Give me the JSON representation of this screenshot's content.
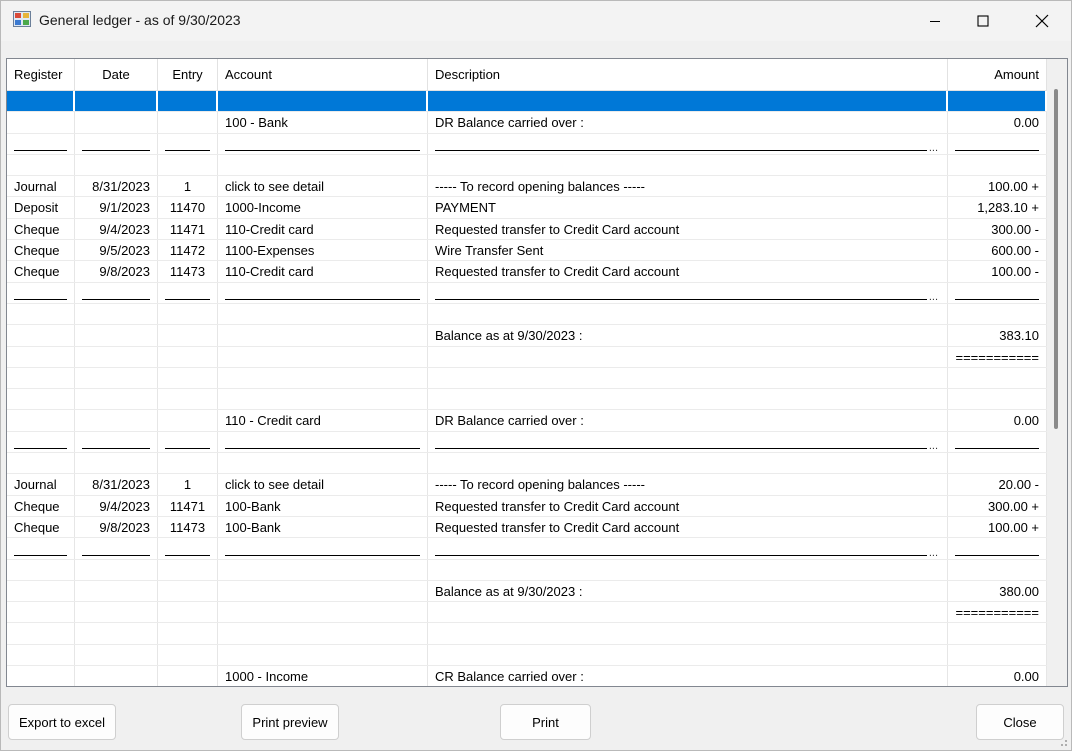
{
  "window": {
    "title": "General ledger - as of 9/30/2023",
    "icon": "ledger-app-icon",
    "controls": [
      "minimize-icon",
      "maximize-icon",
      "close-icon"
    ]
  },
  "grid": {
    "columns": [
      "Register",
      "Date",
      "Entry",
      "Account",
      "Description",
      "Amount"
    ],
    "rows": [
      {
        "type": "selected",
        "cells": [
          "",
          "",
          "",
          "",
          "",
          ""
        ]
      },
      {
        "type": "data",
        "cells": [
          "",
          "",
          "",
          "100 - Bank",
          "DR  Balance carried over  :",
          "0.00"
        ]
      },
      {
        "type": "underline"
      },
      {
        "type": "blank"
      },
      {
        "type": "data",
        "cells": [
          "Journal",
          "8/31/2023",
          "1",
          "click to see detail",
          "----- To record opening balances -----",
          "100.00 +"
        ]
      },
      {
        "type": "data",
        "cells": [
          "Deposit",
          "9/1/2023",
          "11470",
          "1000-Income",
          "PAYMENT",
          "1,283.10 +"
        ]
      },
      {
        "type": "data",
        "cells": [
          "Cheque",
          "9/4/2023",
          "11471",
          "110-Credit card",
          "Requested transfer to Credit Card account",
          "300.00 -"
        ]
      },
      {
        "type": "data",
        "cells": [
          "Cheque",
          "9/5/2023",
          "11472",
          "1100-Expenses",
          "Wire Transfer Sent",
          "600.00 -"
        ]
      },
      {
        "type": "data",
        "cells": [
          "Cheque",
          "9/8/2023",
          "11473",
          "110-Credit card",
          "Requested transfer to Credit Card account",
          "100.00 -"
        ]
      },
      {
        "type": "underline"
      },
      {
        "type": "blank"
      },
      {
        "type": "data",
        "cells": [
          "",
          "",
          "",
          "",
          "Balance as at 9/30/2023 :",
          "383.10"
        ]
      },
      {
        "type": "data",
        "cells": [
          "",
          "",
          "",
          "",
          "",
          "==========="
        ]
      },
      {
        "type": "blank"
      },
      {
        "type": "blank"
      },
      {
        "type": "data",
        "cells": [
          "",
          "",
          "",
          "110 - Credit card",
          "DR  Balance carried over  :",
          "0.00"
        ]
      },
      {
        "type": "underline"
      },
      {
        "type": "blank"
      },
      {
        "type": "data",
        "cells": [
          "Journal",
          "8/31/2023",
          "1",
          "click to see detail",
          "----- To record opening balances -----",
          "20.00 -"
        ]
      },
      {
        "type": "data",
        "cells": [
          "Cheque",
          "9/4/2023",
          "11471",
          "100-Bank",
          "Requested transfer to Credit Card account",
          "300.00 +"
        ]
      },
      {
        "type": "data",
        "cells": [
          "Cheque",
          "9/8/2023",
          "11473",
          "100-Bank",
          "Requested transfer to Credit Card account",
          "100.00 +"
        ]
      },
      {
        "type": "underline"
      },
      {
        "type": "blank"
      },
      {
        "type": "data",
        "cells": [
          "",
          "",
          "",
          "",
          "Balance as at 9/30/2023 :",
          "380.00"
        ]
      },
      {
        "type": "data",
        "cells": [
          "",
          "",
          "",
          "",
          "",
          "==========="
        ]
      },
      {
        "type": "blank"
      },
      {
        "type": "blank"
      },
      {
        "type": "data",
        "cells": [
          "",
          "",
          "",
          "1000 - Income",
          "CR  Balance carried over  :",
          "0.00"
        ]
      }
    ],
    "ellipsis": "..."
  },
  "buttons": {
    "export": "Export to excel",
    "preview": "Print preview",
    "print": "Print",
    "close": "Close"
  },
  "colors": {
    "selection": "#0078d7"
  }
}
